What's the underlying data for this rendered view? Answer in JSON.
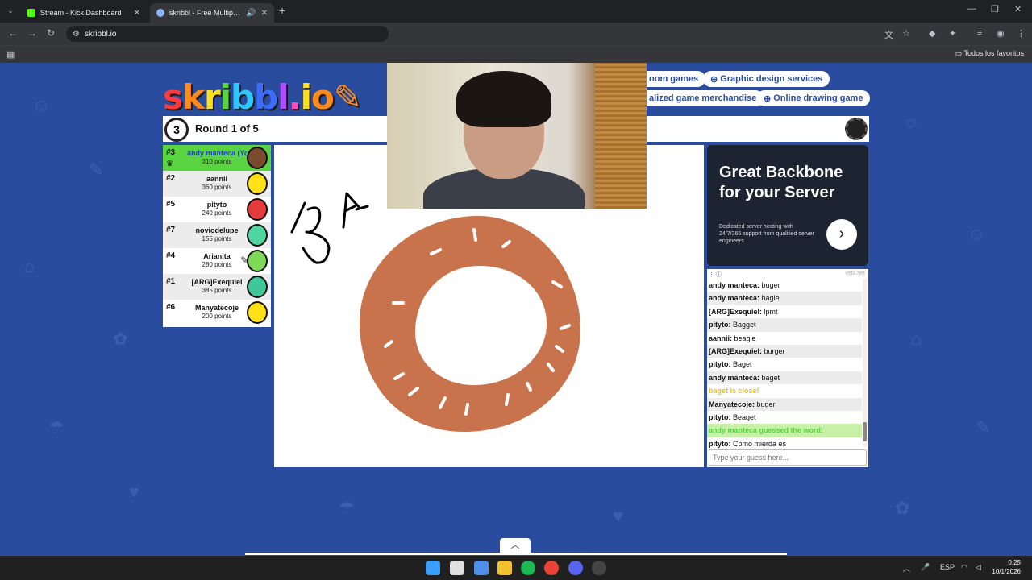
{
  "browser": {
    "tabs": [
      {
        "title": "Stream - Kick Dashboard",
        "favicon_color": "#53fc18"
      },
      {
        "title": "skribbl - Free Multiplayer D",
        "favicon_color": "#8ab4f8"
      }
    ],
    "url": "skribbl.io",
    "bookmarks_all": "Todos los favoritos"
  },
  "site": {
    "logo_letters": [
      "s",
      "k",
      "r",
      "i",
      "b",
      "b",
      "l",
      ".",
      "i",
      "o"
    ],
    "logo_colors": [
      "#ff3b3b",
      "#ff8c1a",
      "#ffe11a",
      "#5bd442",
      "#32c6ff",
      "#3a6cff",
      "#b04cff",
      "#ff4fbf",
      "#ffe11a",
      "#ff8c1a"
    ],
    "pills": [
      {
        "label": "oom games",
        "icon": ""
      },
      {
        "label": "Graphic design services",
        "icon": "⊕"
      },
      {
        "label": "alized game merchandise",
        "icon": ""
      },
      {
        "label": "Online drawing game",
        "icon": "⊕"
      }
    ]
  },
  "game": {
    "round_label": "Round 1 of 5",
    "timer": "3",
    "players": [
      {
        "rank": "#3",
        "name": "andy manteca (You)",
        "points": "310 points",
        "avatar_color": "#7a4a2c",
        "me": true,
        "crown": true
      },
      {
        "rank": "#2",
        "name": "aannii",
        "points": "360 points",
        "avatar_color": "#ffe11a"
      },
      {
        "rank": "#5",
        "name": "pityto",
        "points": "240 points",
        "avatar_color": "#e53b3b"
      },
      {
        "rank": "#7",
        "name": "noviodelupe",
        "points": "155 points",
        "avatar_color": "#4fd6a0"
      },
      {
        "rank": "#4",
        "name": "Arianita",
        "points": "280 points",
        "avatar_color": "#7ed957",
        "drawing": true
      },
      {
        "rank": "#1",
        "name": "[ARG]Exequiel",
        "points": "385 points",
        "avatar_color": "#3fc79a"
      },
      {
        "rank": "#6",
        "name": "Manyatecoje",
        "points": "200 points",
        "avatar_color": "#ffe11a"
      }
    ],
    "canvas_text": "BA"
  },
  "ad": {
    "title": "Great Backbone for your Server",
    "subtitle": "Dedicated server hosting with 24/7/365 support from qualified server engineers",
    "cta_icon": "›"
  },
  "chat": {
    "brand": "vela.net",
    "messages": [
      {
        "name": "andy manteca:",
        "text": "buger"
      },
      {
        "name": "andy manteca:",
        "text": "bagle"
      },
      {
        "name": "[ARG]Exequiel:",
        "text": "lpmt"
      },
      {
        "name": "pityto:",
        "text": "Bagget"
      },
      {
        "name": "aannii:",
        "text": "beagle"
      },
      {
        "name": "[ARG]Exequiel:",
        "text": "burger"
      },
      {
        "name": "pityto:",
        "text": "Baget"
      },
      {
        "name": "andy manteca:",
        "text": "baget"
      },
      {
        "system": "close",
        "text": "baget is close!"
      },
      {
        "name": "Manyatecoje:",
        "text": "buger"
      },
      {
        "name": "pityto:",
        "text": "Beaget"
      },
      {
        "system": "guessed",
        "text": "andy manteca guessed the word!"
      },
      {
        "name": "pityto:",
        "text": "Como mierda es"
      }
    ],
    "input_placeholder": "Type your guess here..."
  },
  "taskbar": {
    "lang": "ESP",
    "time": "0:25",
    "date": "10/1/2026",
    "apps": [
      {
        "name": "windows-start",
        "color": "#3aa0ff"
      },
      {
        "name": "search",
        "color": "#e0e0e0"
      },
      {
        "name": "store",
        "color": "#4f8fe8"
      },
      {
        "name": "file-explorer",
        "color": "#f2c12e"
      },
      {
        "name": "spotify",
        "color": "#1db954"
      },
      {
        "name": "chrome",
        "color": "#ea4335"
      },
      {
        "name": "discord",
        "color": "#5865f2"
      },
      {
        "name": "obs",
        "color": "#444"
      }
    ]
  }
}
